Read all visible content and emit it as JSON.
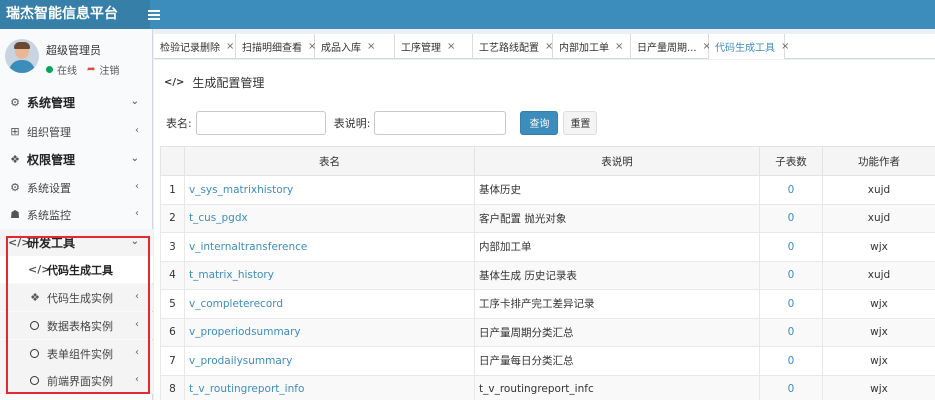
{
  "app": {
    "title": "瑞杰智能信息平台"
  },
  "user": {
    "name": "超级管理员",
    "status": "在线",
    "logout": "注销"
  },
  "sidebar": {
    "items": [
      {
        "label": "系统管理",
        "icon": "gear-icon",
        "glyph": "⚙",
        "chev": "⌄"
      },
      {
        "label": "组织管理",
        "icon": "grid-icon",
        "glyph": "⊞",
        "chev": "‹"
      },
      {
        "label": "权限管理",
        "icon": "cubes-icon",
        "glyph": "❖",
        "chev": "⌄"
      },
      {
        "label": "系统设置",
        "icon": "cog-icon",
        "glyph": "⚙",
        "chev": "‹"
      },
      {
        "label": "系统监控",
        "icon": "monitor-icon",
        "glyph": "☗",
        "chev": "‹"
      },
      {
        "label": "研发工具",
        "icon": "code-icon",
        "glyph": "</>",
        "chev": "⌄"
      },
      {
        "label": "代码生成工具",
        "icon": "code-icon",
        "glyph": "</>",
        "chev": ""
      },
      {
        "label": "代码生成实例",
        "icon": "cubes-icon",
        "glyph": "❖",
        "chev": "‹"
      },
      {
        "label": "数据表格实例",
        "icon": "circle-icon",
        "glyph": "",
        "chev": "‹"
      },
      {
        "label": "表单组件实例",
        "icon": "circle-icon",
        "glyph": "",
        "chev": "‹"
      },
      {
        "label": "前端界面实例",
        "icon": "circle-icon",
        "glyph": "",
        "chev": "‹"
      }
    ]
  },
  "tabs": [
    {
      "label": "检验记录删除",
      "close": "×"
    },
    {
      "label": "扫描明细查看",
      "close": "×"
    },
    {
      "label": "成品入库",
      "close": "×"
    },
    {
      "label": "工序管理",
      "close": "×"
    },
    {
      "label": "工艺路线配置",
      "close": "×"
    },
    {
      "label": "内部加工单",
      "close": "×"
    },
    {
      "label": "日产量周期...",
      "close": "×"
    },
    {
      "label": "代码生成工具",
      "close": "×"
    }
  ],
  "page": {
    "title": "生成配置管理",
    "icon": "</>"
  },
  "search": {
    "table_name_label": "表名:",
    "table_desc_label": "表说明:",
    "table_name_value": "",
    "table_desc_value": "",
    "query_button": "查询",
    "reset_button": "重置"
  },
  "table": {
    "columns": [
      "",
      "表名",
      "表说明",
      "子表数",
      "功能作者"
    ],
    "rows": [
      {
        "no": "1",
        "name": "v_sys_matrixhistory",
        "desc": "基体历史",
        "sub": "0",
        "author": "xujd"
      },
      {
        "no": "2",
        "name": "t_cus_pgdx",
        "desc": "客户配置 抛光对象",
        "sub": "0",
        "author": "xujd"
      },
      {
        "no": "3",
        "name": "v_internaltransference",
        "desc": "内部加工单",
        "sub": "0",
        "author": "wjx"
      },
      {
        "no": "4",
        "name": "t_matrix_history",
        "desc": "基体生成 历史记录表",
        "sub": "0",
        "author": "xujd"
      },
      {
        "no": "5",
        "name": "v_completerecord",
        "desc": "工序卡排产完工差异记录",
        "sub": "0",
        "author": "wjx"
      },
      {
        "no": "6",
        "name": "v_properiodsummary",
        "desc": "日产量周期分类汇总",
        "sub": "0",
        "author": "wjx"
      },
      {
        "no": "7",
        "name": "v_prodailysummary",
        "desc": "日产量每日分类汇总",
        "sub": "0",
        "author": "wjx"
      },
      {
        "no": "8",
        "name": "t_v_routingreport_info",
        "desc": "t_v_routingreport_infc",
        "sub": "0",
        "author": "wjx"
      }
    ]
  },
  "colors": {
    "header": "#3c8dbc",
    "logo_bg": "#367fa9",
    "highlight_box": "#e5282d",
    "online": "#00a65a"
  }
}
